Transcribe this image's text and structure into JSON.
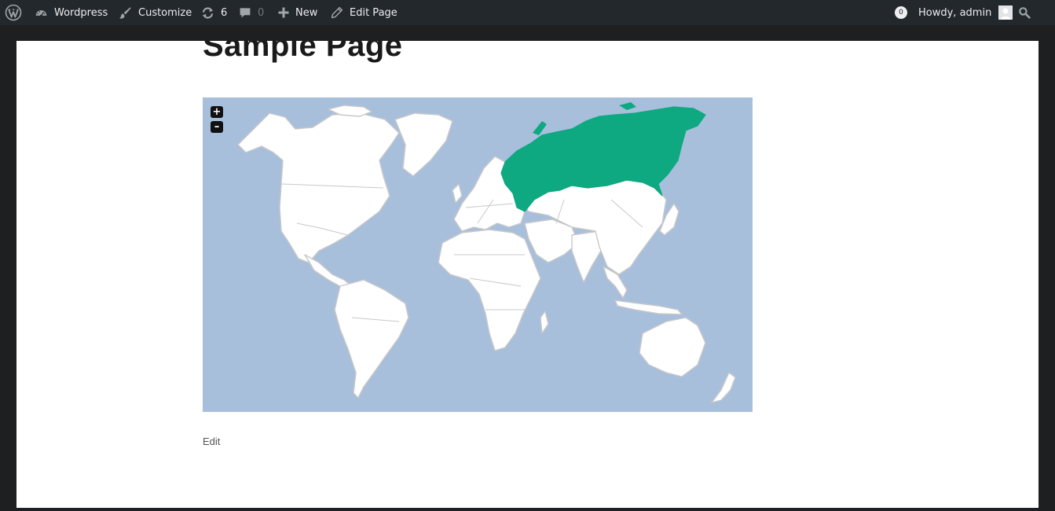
{
  "adminbar": {
    "site_name": "Wordpress",
    "customize": "Customize",
    "updates_count": "6",
    "comments_count": "0",
    "new_label": "New",
    "edit_page": "Edit Page",
    "notifications_count": "0",
    "greeting": "Howdy, admin",
    "icons": [
      "wordpress-icon",
      "dashboard-icon",
      "brush-icon",
      "refresh-icon",
      "comment-icon",
      "plus-icon",
      "pencil-icon",
      "search-icon"
    ]
  },
  "page": {
    "title": "Sample Page",
    "edit_link": "Edit"
  },
  "map": {
    "zoom_in": "+",
    "zoom_out": "–",
    "ocean_color": "#a8bfdc",
    "land_color": "#ffffff",
    "border_color": "#c8c8c8",
    "highlight_color": "#0ea881",
    "highlighted_region": "Russia"
  }
}
